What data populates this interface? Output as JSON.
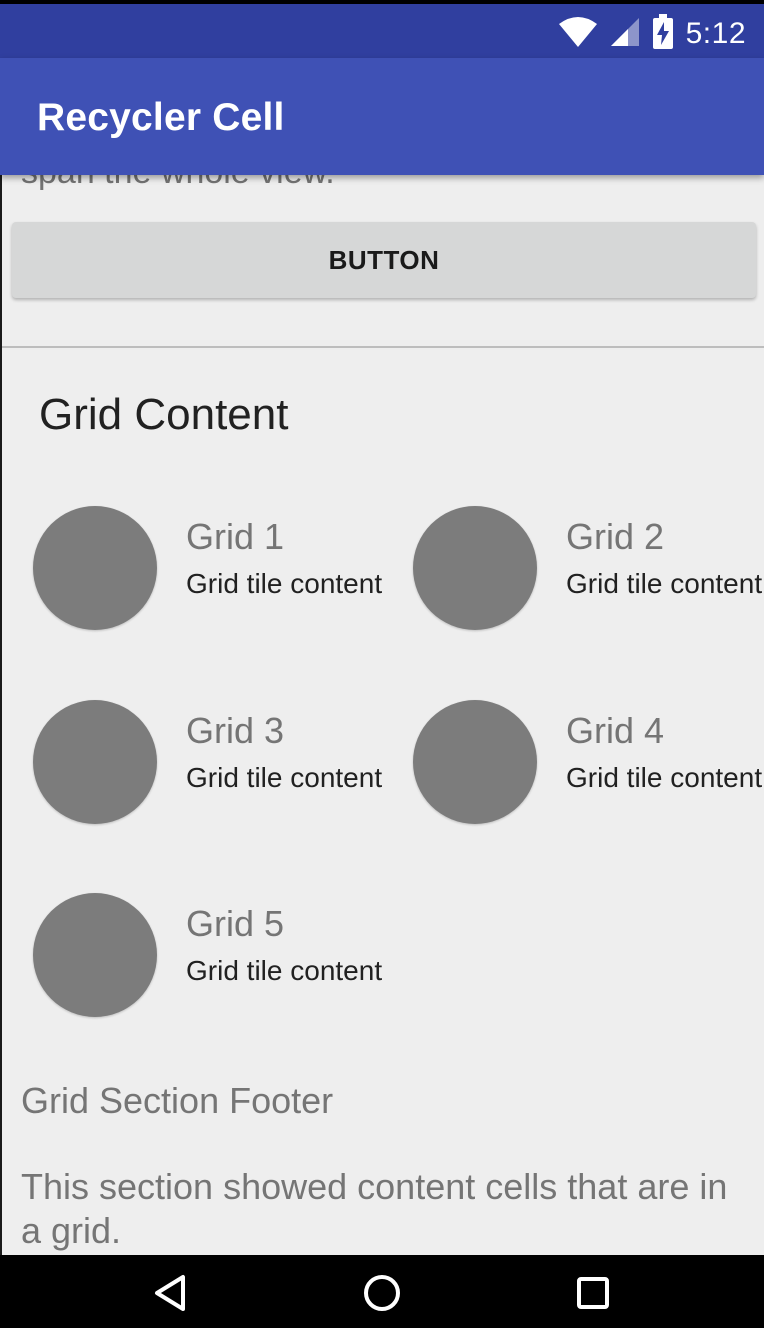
{
  "status_bar": {
    "time": "5:12",
    "icons": [
      "wifi-icon",
      "cell-signal-icon",
      "battery-charging-icon"
    ]
  },
  "app_bar": {
    "title": "Recycler Cell"
  },
  "content": {
    "cut_text": "span the whole view.",
    "button_label": "BUTTON",
    "section_title": "Grid Content",
    "grid_tiles": [
      {
        "title": "Grid 1",
        "body": "Grid tile content"
      },
      {
        "title": "Grid 2",
        "body": "Grid tile content"
      },
      {
        "title": "Grid 3",
        "body": "Grid tile content"
      },
      {
        "title": "Grid 4",
        "body": "Grid tile content"
      },
      {
        "title": "Grid 5",
        "body": "Grid tile content"
      }
    ],
    "footer": "Grid Section Footer",
    "description": "This section showed content cells that are in a grid."
  },
  "nav_bar": {
    "icons": [
      "back-icon",
      "home-icon",
      "recents-icon"
    ]
  },
  "colors": {
    "status_bar": "#303F9F",
    "app_bar": "#3F51B5",
    "background": "#EEEEEE",
    "avatar": "#7C7C7C"
  }
}
